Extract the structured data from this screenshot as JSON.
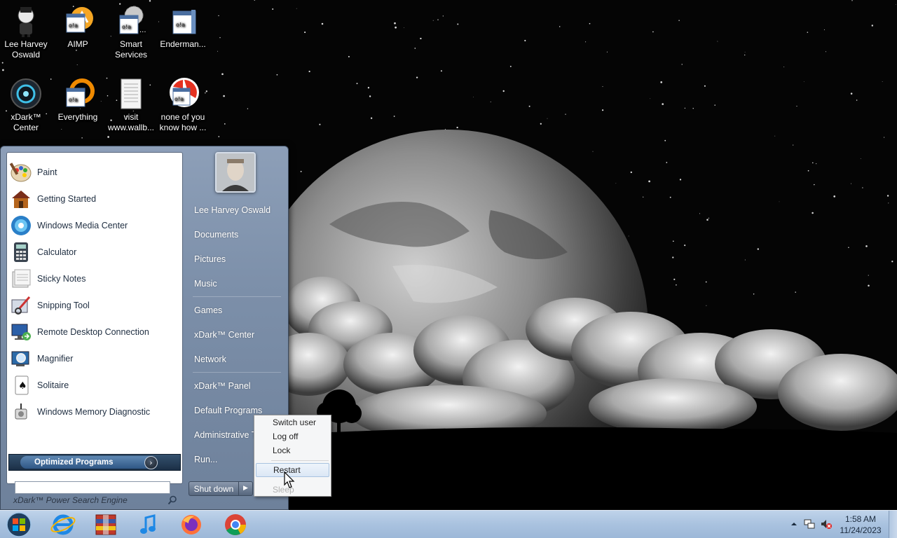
{
  "desktop": {
    "icons": [
      {
        "label": "Lee Harvey Oswald"
      },
      {
        "label": "AIMP"
      },
      {
        "label": "Smart Services"
      },
      {
        "label": "Enderman..."
      },
      {
        "label": "xDark™ Center"
      },
      {
        "label": "Everything"
      },
      {
        "label": "visit www.wallb..."
      },
      {
        "label": "none of you know how ..."
      }
    ]
  },
  "start_menu": {
    "programs": [
      {
        "label": "Paint",
        "icon": "paint-icon"
      },
      {
        "label": "Getting Started",
        "icon": "getting-started-icon"
      },
      {
        "label": "Windows Media Center",
        "icon": "media-center-icon"
      },
      {
        "label": "Calculator",
        "icon": "calculator-icon"
      },
      {
        "label": "Sticky Notes",
        "icon": "sticky-notes-icon"
      },
      {
        "label": "Snipping Tool",
        "icon": "snipping-tool-icon"
      },
      {
        "label": "Remote Desktop Connection",
        "icon": "remote-desktop-icon"
      },
      {
        "label": "Magnifier",
        "icon": "magnifier-icon"
      },
      {
        "label": "Solitaire",
        "icon": "solitaire-icon"
      },
      {
        "label": "Windows Memory Diagnostic",
        "icon": "memory-diagnostic-icon"
      }
    ],
    "optimized_label": "Optimized Programs",
    "search_placeholder": "xDark™ Power Search Engine",
    "right_items": [
      {
        "label": "Lee Harvey Oswald"
      },
      {
        "label": "Documents"
      },
      {
        "label": "Pictures"
      },
      {
        "label": "Music"
      },
      {
        "label": "Games"
      },
      {
        "label": "xDark™ Center"
      },
      {
        "label": "Network"
      },
      {
        "label": "xDark™ Panel"
      },
      {
        "label": "Default Programs"
      },
      {
        "label": "Administrative Tools"
      },
      {
        "label": "Run..."
      }
    ],
    "shutdown_label": "Shut down"
  },
  "power_menu": {
    "items": [
      {
        "label": "Switch user"
      },
      {
        "label": "Log off"
      },
      {
        "label": "Lock"
      },
      {
        "label": "Restart",
        "state": "hover"
      },
      {
        "label": "Sleep",
        "state": "disabled"
      }
    ]
  },
  "taskbar": {
    "pinned": [
      "internet-explorer-icon",
      "archive-icon",
      "itunes-icon",
      "firefox-icon",
      "chrome-icon"
    ],
    "clock_time": "1:58 AM",
    "clock_date": "11/24/2023"
  },
  "colors": {
    "start_menu_bg": "#7c8fa9",
    "taskbar_bg": "#a9c2df",
    "hover_highlight": "#dbe7f5"
  }
}
